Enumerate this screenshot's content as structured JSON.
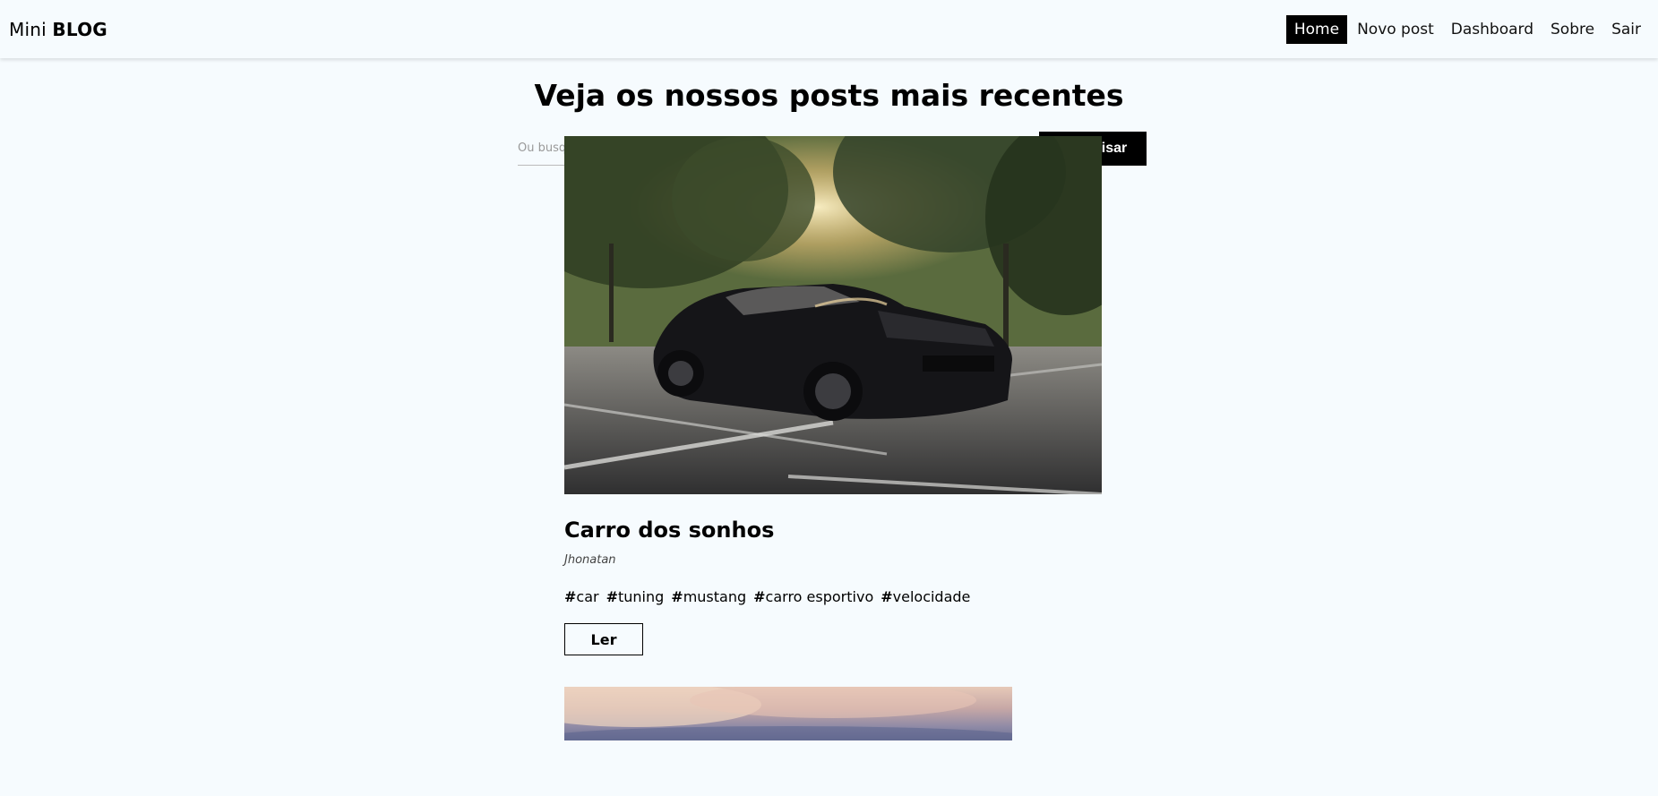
{
  "navbar": {
    "brand_light": "Mini ",
    "brand_bold": "BLOG",
    "links": [
      {
        "label": "Home",
        "active": true
      },
      {
        "label": "Novo post",
        "active": false
      },
      {
        "label": "Dashboard",
        "active": false
      },
      {
        "label": "Sobre",
        "active": false
      },
      {
        "label": "Sair",
        "active": false
      }
    ]
  },
  "main": {
    "title": "Veja os nossos posts mais recentes",
    "search": {
      "placeholder": "Ou busque por tags...",
      "value": "",
      "button_label": "Pesquisar"
    },
    "posts": [
      {
        "image_icon": "car-photo",
        "title": "Carro dos sonhos",
        "author": "Jhonatan",
        "tags": [
          {
            "hash": "#",
            "name": "car"
          },
          {
            "hash": "#",
            "name": "tuning"
          },
          {
            "hash": "#",
            "name": "mustang"
          },
          {
            "hash": "#",
            "name": "carro esportivo"
          },
          {
            "hash": "#",
            "name": "velocidade"
          }
        ],
        "read_label": "Ler"
      }
    ],
    "next_post_image_icon": "sky-photo"
  },
  "colors": {
    "background": "#f6fbfe",
    "accent": "#000000",
    "accent_text": "#ffffff"
  }
}
